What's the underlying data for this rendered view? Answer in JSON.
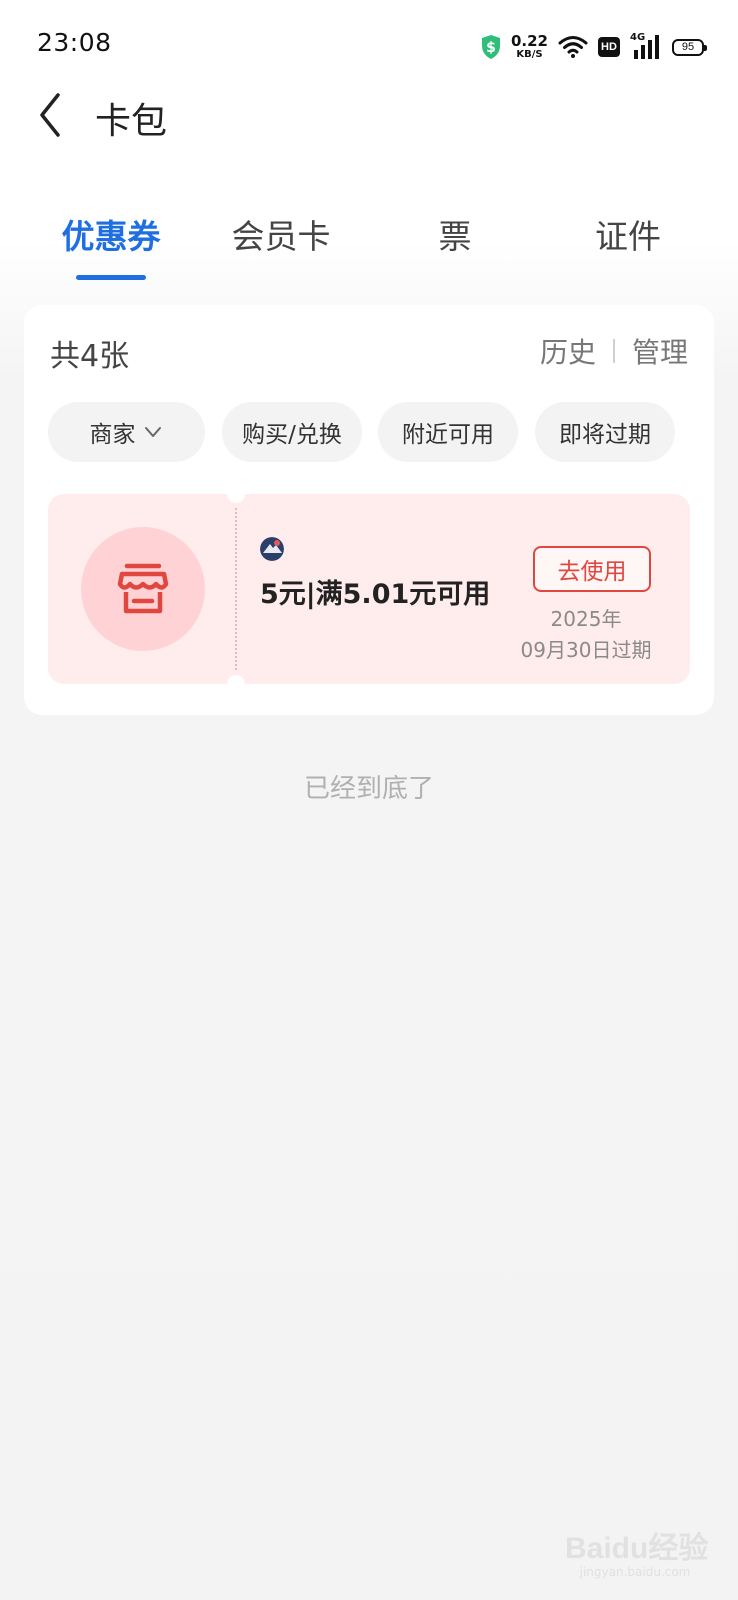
{
  "status_bar": {
    "time": "23:08",
    "net_speed_value": "0.22",
    "net_speed_unit": "KB/S",
    "hd_label": "HD",
    "network_label": "4G",
    "battery_level": "95",
    "icons": [
      "shield-dollar-icon",
      "wifi-icon",
      "hd-icon",
      "signal-icon",
      "battery-icon"
    ]
  },
  "header": {
    "title": "卡包",
    "back_icon": "chevron-left-icon"
  },
  "tabs": [
    {
      "label": "优惠券",
      "active": true
    },
    {
      "label": "会员卡",
      "active": false
    },
    {
      "label": "票",
      "active": false
    },
    {
      "label": "证件",
      "active": false
    }
  ],
  "summary": {
    "count_text": "共4张",
    "history_label": "历史",
    "manage_label": "管理"
  },
  "filters": [
    {
      "label": "商家",
      "has_dropdown": true
    },
    {
      "label": "购买/兑换"
    },
    {
      "label": "附近可用"
    },
    {
      "label": "即将过期"
    }
  ],
  "coupon": {
    "icon": "shop-icon",
    "title": "5元|满5.01元可用",
    "use_label": "去使用",
    "expiry_year": "2025年",
    "expiry_date": "09月30日过期"
  },
  "footer": {
    "end_text": "已经到底了"
  },
  "watermark": {
    "text": "Baidu经验",
    "sub": "jingyan.baidu.com"
  },
  "colors": {
    "accent": "#1f6fe0",
    "coupon_bg": "#ffeced",
    "coupon_red": "#e0483f",
    "status_green": "#2fbd7a"
  }
}
